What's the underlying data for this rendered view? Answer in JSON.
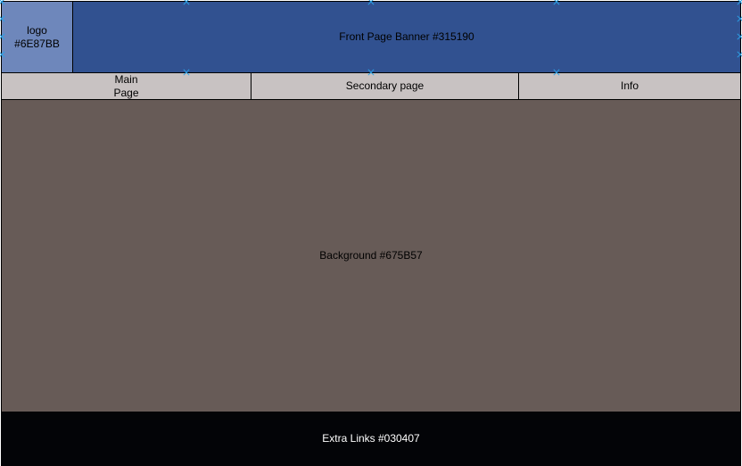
{
  "logo": {
    "label": "logo\n#6E87BB",
    "color": "#6E87BB"
  },
  "banner": {
    "label": "Front Page Banner #315190",
    "color": "#315190"
  },
  "nav": {
    "color": "#C8C2C2",
    "items": [
      {
        "label": "Main\nPage"
      },
      {
        "label": "Secondary page"
      },
      {
        "label": "Info"
      }
    ]
  },
  "main": {
    "label": "Background #675B57",
    "color": "#675B57"
  },
  "footer": {
    "label": "Extra Links #030407",
    "color": "#030407"
  },
  "selection_handle_color": "#29A3E8"
}
